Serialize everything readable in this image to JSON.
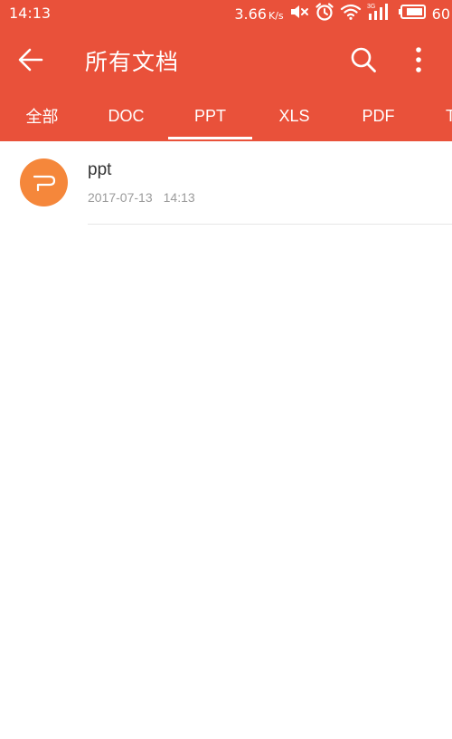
{
  "status_bar": {
    "time": "14:13",
    "net_speed": "3.66",
    "net_speed_unit": "K/s",
    "battery_level": "60",
    "icons": [
      "mute-icon",
      "alarm-icon",
      "wifi-icon",
      "signal-3g-icon",
      "battery-icon"
    ]
  },
  "toolbar": {
    "title": "所有文档",
    "back_icon": "back-arrow-icon",
    "search_icon": "search-icon",
    "more_icon": "more-vertical-icon"
  },
  "tabs": [
    {
      "label": "全部",
      "selected": false
    },
    {
      "label": "DOC",
      "selected": false
    },
    {
      "label": "PPT",
      "selected": true
    },
    {
      "label": "XLS",
      "selected": false
    },
    {
      "label": "PDF",
      "selected": false
    },
    {
      "label": "T",
      "selected": false
    }
  ],
  "files": [
    {
      "name": "ppt",
      "date": "2017-07-13",
      "time": "14:13",
      "icon": "ppt-file-icon"
    }
  ],
  "colors": {
    "accent": "#e9513a",
    "ppt_icon": "#f5873b",
    "meta_text": "#9b9b9b",
    "divider": "#e6e6e6"
  }
}
